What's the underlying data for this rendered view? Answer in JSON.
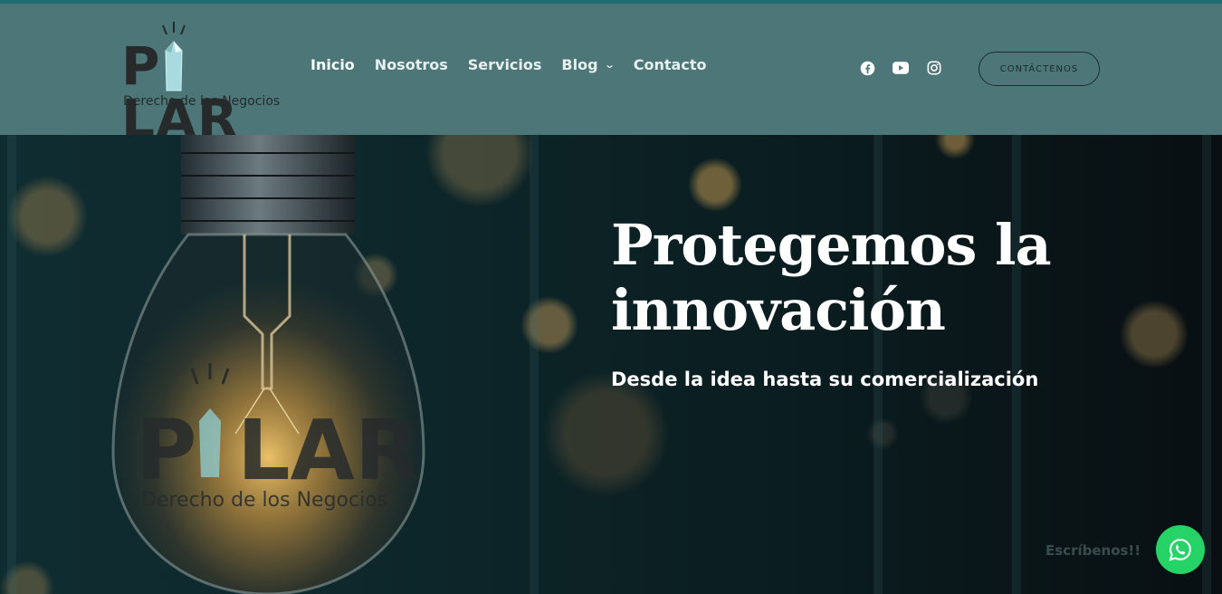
{
  "brand": {
    "wordmark_left": "P",
    "wordmark_right": "LAR",
    "tagline": "Derecho de los Negocios"
  },
  "nav": {
    "items": [
      {
        "label": "Inicio",
        "active": true
      },
      {
        "label": "Nosotros"
      },
      {
        "label": "Servicios"
      },
      {
        "label": "Blog",
        "has_dropdown": true
      },
      {
        "label": "Contacto"
      }
    ]
  },
  "social": [
    "facebook-icon",
    "youtube-icon",
    "instagram-icon"
  ],
  "cta": {
    "label": "CONTÁCTENOS"
  },
  "hero": {
    "title_line1": "Protegemos la",
    "title_line2": "innovación",
    "subtitle": "Desde la idea hasta su comercialización",
    "bulb_logo_left": "P",
    "bulb_logo_right": "LAR",
    "bulb_logo_tagline": "Derecho de los Negocios"
  },
  "whatsapp": {
    "label": "Escríbenos!!"
  },
  "colors": {
    "header_bg": "#4d7678",
    "top_line": "#1e6d6f",
    "whatsapp": "#25d366",
    "text_dark": "#262a2b"
  }
}
